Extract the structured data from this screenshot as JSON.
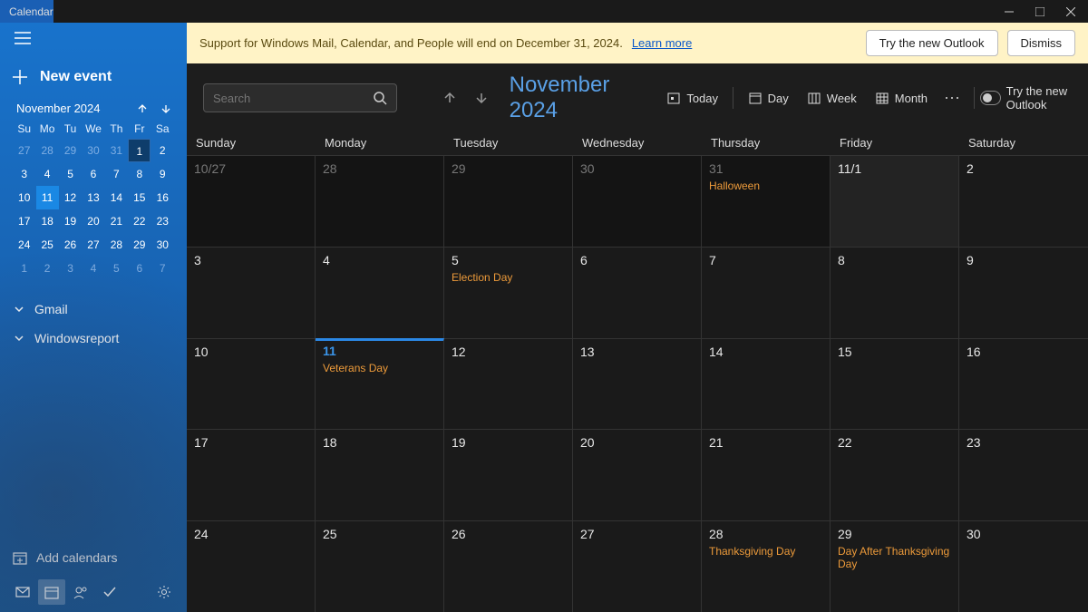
{
  "app": {
    "title": "Calendar"
  },
  "banner": {
    "text": "Support for Windows Mail, Calendar, and People will end on December 31, 2024. ",
    "link": "Learn more",
    "try_btn": "Try the new Outlook",
    "dismiss_btn": "Dismiss"
  },
  "sidebar": {
    "new_event": "New event",
    "minical_title": "November 2024",
    "dow": [
      "Su",
      "Mo",
      "Tu",
      "We",
      "Th",
      "Fr",
      "Sa"
    ],
    "weeks": [
      [
        {
          "n": "27",
          "o": true
        },
        {
          "n": "28",
          "o": true
        },
        {
          "n": "29",
          "o": true
        },
        {
          "n": "30",
          "o": true
        },
        {
          "n": "31",
          "o": true
        },
        {
          "n": "1",
          "first": true
        },
        {
          "n": "2"
        }
      ],
      [
        {
          "n": "3"
        },
        {
          "n": "4"
        },
        {
          "n": "5"
        },
        {
          "n": "6"
        },
        {
          "n": "7"
        },
        {
          "n": "8"
        },
        {
          "n": "9"
        }
      ],
      [
        {
          "n": "10"
        },
        {
          "n": "11",
          "today": true
        },
        {
          "n": "12"
        },
        {
          "n": "13"
        },
        {
          "n": "14"
        },
        {
          "n": "15"
        },
        {
          "n": "16"
        }
      ],
      [
        {
          "n": "17"
        },
        {
          "n": "18"
        },
        {
          "n": "19"
        },
        {
          "n": "20"
        },
        {
          "n": "21"
        },
        {
          "n": "22"
        },
        {
          "n": "23"
        }
      ],
      [
        {
          "n": "24"
        },
        {
          "n": "25"
        },
        {
          "n": "26"
        },
        {
          "n": "27"
        },
        {
          "n": "28"
        },
        {
          "n": "29"
        },
        {
          "n": "30"
        }
      ],
      [
        {
          "n": "1",
          "o": true
        },
        {
          "n": "2",
          "o": true
        },
        {
          "n": "3",
          "o": true
        },
        {
          "n": "4",
          "o": true
        },
        {
          "n": "5",
          "o": true
        },
        {
          "n": "6",
          "o": true
        },
        {
          "n": "7",
          "o": true
        }
      ]
    ],
    "accounts": [
      "Gmail",
      "Windowsreport"
    ],
    "add_calendars": "Add calendars"
  },
  "toolbar": {
    "search_placeholder": "Search",
    "month_title": "November 2024",
    "today": "Today",
    "day": "Day",
    "week": "Week",
    "month": "Month",
    "try_new": "Try the new Outlook"
  },
  "dayheaders": [
    "Sunday",
    "Monday",
    "Tuesday",
    "Wednesday",
    "Thursday",
    "Friday",
    "Saturday"
  ],
  "cells": [
    {
      "n": "10/27",
      "o": true,
      "dark": true
    },
    {
      "n": "28",
      "o": true,
      "dark": true
    },
    {
      "n": "29",
      "o": true,
      "dark": true
    },
    {
      "n": "30",
      "o": true,
      "dark": true
    },
    {
      "n": "31",
      "o": true,
      "dark": true,
      "ev": "Halloween"
    },
    {
      "n": "11/1",
      "fri": true
    },
    {
      "n": "2"
    },
    {
      "n": "3"
    },
    {
      "n": "4"
    },
    {
      "n": "5",
      "ev": "Election Day"
    },
    {
      "n": "6"
    },
    {
      "n": "7"
    },
    {
      "n": "8"
    },
    {
      "n": "9"
    },
    {
      "n": "10"
    },
    {
      "n": "11",
      "today": true,
      "ev": "Veterans Day"
    },
    {
      "n": "12"
    },
    {
      "n": "13"
    },
    {
      "n": "14"
    },
    {
      "n": "15"
    },
    {
      "n": "16"
    },
    {
      "n": "17"
    },
    {
      "n": "18"
    },
    {
      "n": "19"
    },
    {
      "n": "20"
    },
    {
      "n": "21"
    },
    {
      "n": "22"
    },
    {
      "n": "23"
    },
    {
      "n": "24"
    },
    {
      "n": "25"
    },
    {
      "n": "26"
    },
    {
      "n": "27"
    },
    {
      "n": "28",
      "ev": "Thanksgiving Day"
    },
    {
      "n": "29",
      "ev": "Day After Thanksgiving Day"
    },
    {
      "n": "30"
    }
  ]
}
